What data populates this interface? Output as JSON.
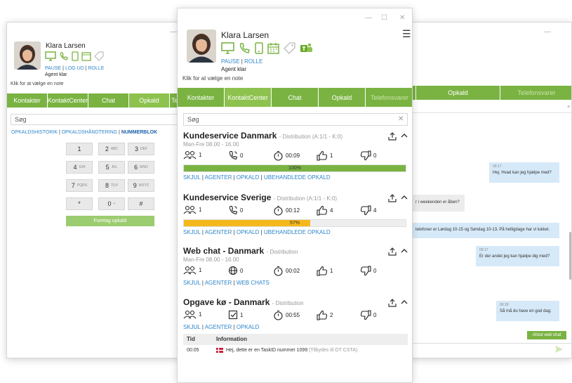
{
  "colors": {
    "accent_green": "#7ab342",
    "link_blue": "#2e86c9",
    "bar_green": "#7ab342",
    "bar_yellow": "#f5b81c"
  },
  "left": {
    "name": "Klara Larsen",
    "links": [
      "PAUSE",
      "LOG UD",
      "ROLLE"
    ],
    "status": "Agent klar",
    "note": "Klik for at vælge en note",
    "tabs": [
      "Kontakter",
      "KontaktCenter",
      "Chat",
      "Opkald",
      "Te"
    ],
    "search": "Søg",
    "sublinks": [
      "OPKALDSHISTORIK",
      "OPKALDSHÅNDTERING",
      "NUMMERBLOK"
    ],
    "keys": [
      {
        "d": "1",
        "l": ""
      },
      {
        "d": "2",
        "l": "ABC"
      },
      {
        "d": "3",
        "l": "DEF"
      },
      {
        "d": "4",
        "l": "GHI"
      },
      {
        "d": "5",
        "l": "JKL"
      },
      {
        "d": "6",
        "l": "MNO"
      },
      {
        "d": "7",
        "l": "PQRS"
      },
      {
        "d": "8",
        "l": "TUV"
      },
      {
        "d": "9",
        "l": "WXYZ"
      },
      {
        "d": "*",
        "l": ""
      },
      {
        "d": "0",
        "l": "+"
      },
      {
        "d": "#",
        "l": ""
      }
    ],
    "call_button": "Foretag opkald"
  },
  "center": {
    "name": "Klara Larsen",
    "links": [
      "PAUSE",
      "ROLLE"
    ],
    "status": "Agent klar",
    "note": "Klik for at vælge en note",
    "tabs": [
      "Kontakter",
      "KontaktCenter",
      "Chat",
      "Opkald",
      "Telefonsvarer"
    ],
    "search": "Søg",
    "queues": [
      {
        "title": "Kundeservice Danmark",
        "sub": "- Distribution (A:1/1 - K:0)",
        "hours": "Man-Fre 08.00 - 16.00",
        "agents": "1",
        "calls": "0",
        "time": "00:09",
        "likes": "1",
        "dislikes": "0",
        "progress": 100,
        "progress_label": "100%",
        "bar_color": "#7ab342",
        "links": [
          "SKJUL",
          "AGENTER",
          "OPKALD",
          "UBEHANDLEDE OPKALD"
        ]
      },
      {
        "title": "Kundeservice Sverige",
        "sub": "- Distribution (A:1/1 - K:0)",
        "hours": "",
        "agents": "1",
        "calls": "0",
        "time": "00:12",
        "likes": "4",
        "dislikes": "4",
        "progress": 57,
        "progress_label": "57%",
        "bar_color": "#f5b81c",
        "links": [
          "SKJUL",
          "AGENTER",
          "OPKALD",
          "UBEHANDLEDE OPKALD"
        ]
      },
      {
        "title": "Web chat - Danmark",
        "sub": "- Distribution",
        "hours": "Man-Fre 08.00 - 16.00",
        "agents": "1",
        "calls": "0",
        "time": "00:02",
        "likes": "1",
        "dislikes": "0",
        "links": [
          "SKJUL",
          "AGENTER",
          "WEB CHATS"
        ]
      },
      {
        "title": "Opgave kø - Danmark",
        "sub": "- Distribution",
        "hours": "",
        "agents": "1",
        "calls": "1",
        "time": "00:55",
        "likes": "2",
        "dislikes": "0",
        "links": [
          "SKJUL",
          "AGENTER",
          "OPKALD"
        ]
      }
    ],
    "task_table": {
      "headers": [
        "Tid",
        "Information"
      ],
      "rows": [
        {
          "time": "00:05",
          "info": "Hej, dette er en TaskID nummer 1099",
          "extra": "(Tilbydes til OT CSTA)"
        }
      ]
    }
  },
  "right": {
    "tabs": [
      "Opkald",
      "Telefonsvarer"
    ],
    "messages": [
      {
        "side": "right",
        "time": "09:17",
        "text": "Hej. Hvad kan jeg hjælpe med?"
      },
      {
        "side": "left",
        "time": "",
        "text": "r i weekenden er åben?"
      },
      {
        "side": "right",
        "time": "",
        "text": "telefoner er Lørdag 10-15 og Søndag 10-13. På helligdage har vi lukket."
      },
      {
        "side": "right",
        "time": "09:17",
        "text": "Er der andet jeg kan hjælpe dig med?"
      },
      {
        "side": "right",
        "time": "09:18",
        "text": "Så må du have en god dag."
      }
    ],
    "end_chat": "Afslut web chat"
  }
}
